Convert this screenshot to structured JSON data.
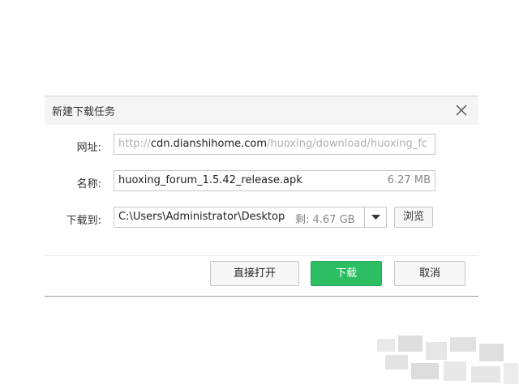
{
  "dialog": {
    "title": "新建下载任务"
  },
  "form": {
    "url_label": "网址:",
    "url_scheme": "http://",
    "url_host": "cdn.dianshihome.com",
    "url_path": "/huoxing/download/huoxing_fc",
    "name_label": "名称:",
    "file_name": "huoxing_forum_1.5.42_release.apk",
    "file_size": "6.27 MB",
    "save_label": "下载到:",
    "save_path": "C:\\Users\\Administrator\\Desktop",
    "free_space": "剩: 4.67 GB",
    "browse_label": "浏览"
  },
  "actions": {
    "open_directly": "直接打开",
    "download": "下载",
    "cancel": "取消"
  },
  "colors": {
    "primary": "#2dbd63",
    "title_bar": "#f5f5f5",
    "border": "#c6c6c6"
  },
  "icons": {
    "close": "close-icon",
    "dropdown": "chevron-down-icon"
  }
}
